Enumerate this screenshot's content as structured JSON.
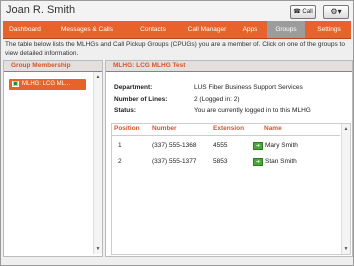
{
  "user": {
    "name": "Joan R. Smith"
  },
  "toolbar": {
    "call_label": "Call",
    "phone_icon": "phone-icon",
    "gear_icon": "gear-icon"
  },
  "nav": {
    "tabs": [
      {
        "label": "Dashboard"
      },
      {
        "label": "Messages & Calls"
      },
      {
        "label": "Contacts"
      },
      {
        "label": "Call Manager"
      },
      {
        "label": "Apps"
      },
      {
        "label": "Groups",
        "active": true
      },
      {
        "label": "Settings"
      }
    ],
    "active_color": "#9c9c9c",
    "accent_color": "#e8622b"
  },
  "intro": "The table below lists the MLHGs and Call Pickup Groups (CPUGs) you are a member of. Click on one of the groups to view detailed information.",
  "group_panel": {
    "title": "Group Membership",
    "items": [
      {
        "label": "MLHG: LCG ML...",
        "icon": "group-icon"
      }
    ]
  },
  "detail": {
    "title": "MLHG: LCG MLHG Test",
    "department_label": "Department:",
    "department_value": "LUS Fiber Business Support Services",
    "lines_label": "Number of Lines:",
    "lines_value": "2  (Logged in: 2)",
    "status_label": "Status:",
    "status_value": "You are currently logged in to this MLHG",
    "table": {
      "headers": [
        "Position",
        "Number",
        "Extension",
        "Name"
      ],
      "rows": [
        {
          "position": "1",
          "number": "(337) 555-1368",
          "extension": "4555",
          "name": "Mary Smith",
          "status_icon": "presence-icon"
        },
        {
          "position": "2",
          "number": "(337) 555-1377",
          "extension": "5853",
          "name": "Stan Smith",
          "status_icon": "presence-icon"
        }
      ]
    }
  }
}
